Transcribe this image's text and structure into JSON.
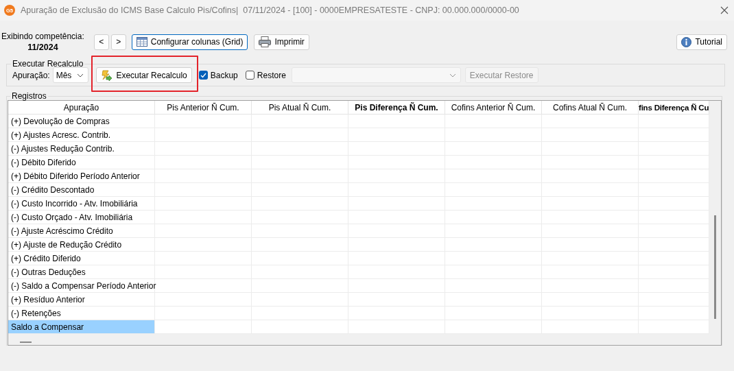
{
  "window": {
    "app_badge": "G5",
    "title": "Apuração de Exclusão do ICMS Base Calculo Pis/Cofins|  07/11/2024 - [100] - 0000EMPRESATESTE - CNPJ: 00.000.000/0000-00"
  },
  "toolbar": {
    "period_label": "Exibindo competência:",
    "period": "11/2024",
    "prev": "<",
    "next": ">",
    "buttons": [
      {
        "label": "Configurar colunas (Grid)",
        "kind": "grid",
        "focused": true
      },
      {
        "label": "Imprimir",
        "kind": "print",
        "focused": false
      }
    ],
    "tutorial": "Tutorial"
  },
  "recalc": {
    "title": "Executar Recalculo",
    "apuracao_label": "Apuração:",
    "apuracao_value": "Mês",
    "run_button": "Executar Recalculo",
    "highlighted": true,
    "backup": {
      "label": "Backup",
      "checked": true
    },
    "restore": {
      "label": "Restore",
      "checked": false
    },
    "restore_select": {
      "disabled": true
    },
    "restore_button": {
      "label": "Executar Restore",
      "disabled": true
    }
  },
  "registros": {
    "title": "Registros",
    "columns": [
      {
        "label": "Apuração",
        "bold": false
      },
      {
        "label": "Pis Anterior Ñ Cum.",
        "bold": false
      },
      {
        "label": "Pis Atual Ñ Cum.",
        "bold": false
      },
      {
        "label": "Pis Diferença Ñ Cum.",
        "bold": true
      },
      {
        "label": "Cofins Anterior Ñ Cum.",
        "bold": false
      },
      {
        "label": "Cofins Atual Ñ Cum.",
        "bold": false
      },
      {
        "label": "fins Diferença Ñ Cu",
        "bold": true
      }
    ],
    "rows": [
      {
        "label": "(+) Devolução de Compras",
        "selected": false
      },
      {
        "label": "(+) Ajustes Acresc. Contrib.",
        "selected": false
      },
      {
        "label": "(-) Ajustes Redução Contrib.",
        "selected": false
      },
      {
        "label": "(-) Débito Diferido",
        "selected": false
      },
      {
        "label": "(+) Débito Diferido Período Anterior",
        "selected": false
      },
      {
        "label": "(-) Crédito Descontado",
        "selected": false
      },
      {
        "label": "(-) Custo Incorrido - Atv. Imobiliária",
        "selected": false
      },
      {
        "label": "(-) Custo Orçado - Atv. Imobiliária",
        "selected": false
      },
      {
        "label": "(-) Ajuste Acréscimo Crédito",
        "selected": false
      },
      {
        "label": "(+) Ajuste de Redução Crédito",
        "selected": false
      },
      {
        "label": "(+) Crédito Diferido",
        "selected": false
      },
      {
        "label": "(-) Outras Deduções",
        "selected": false
      },
      {
        "label": "(-) Saldo a Compensar Período Anterior",
        "selected": false
      },
      {
        "label": "(+) Resíduo Anterior",
        "selected": false
      },
      {
        "label": "(-) Retenções",
        "selected": false
      },
      {
        "label": "Saldo a Compensar",
        "selected": true
      }
    ]
  }
}
